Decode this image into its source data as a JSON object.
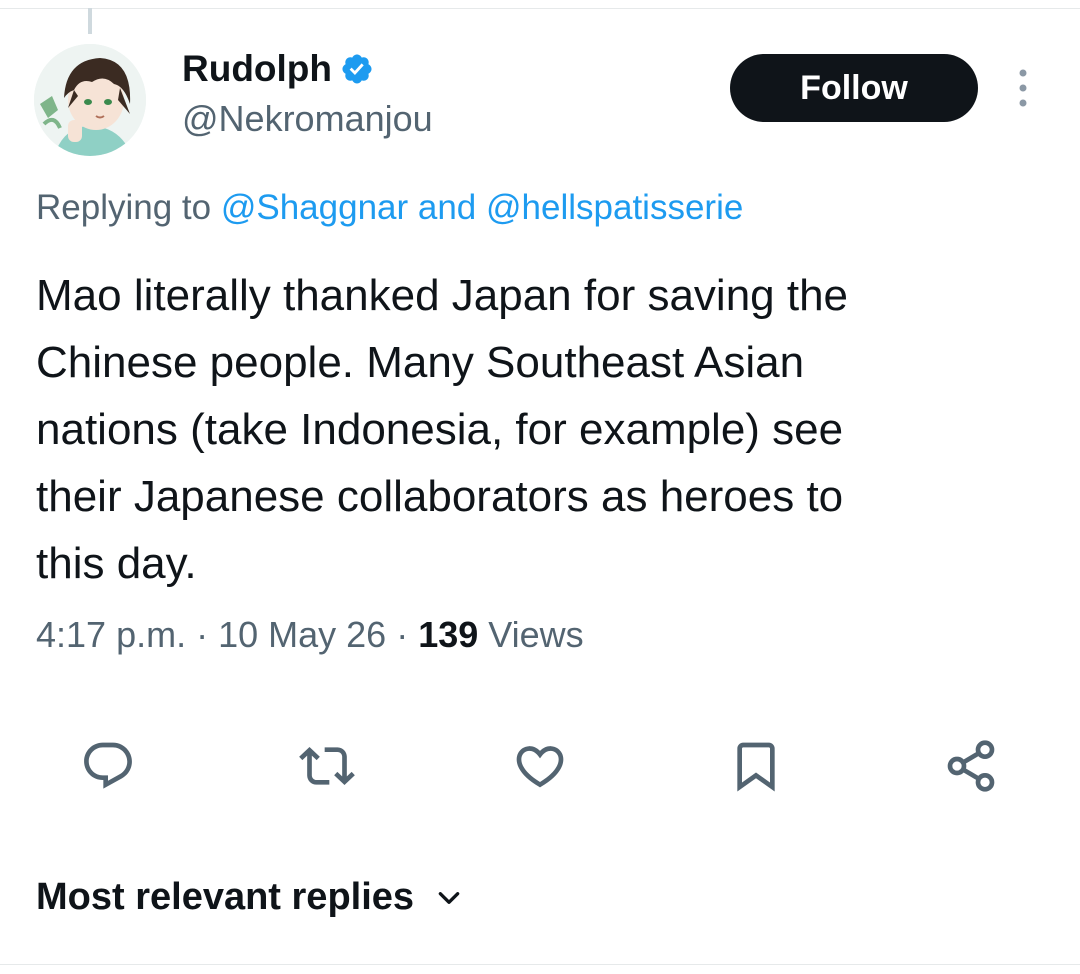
{
  "tweet": {
    "author_name": "Rudolph",
    "author_handle": "@Nekromanjou",
    "follow_label": "Follow",
    "replying_prefix": "Replying to ",
    "replying_to": [
      "@Shaggnar",
      "@hellspatisserie"
    ],
    "replying_joiner": " and ",
    "text": "Mao literally thanked Japan for saving the\nChinese people. Many Southeast Asian\nnations (take Indonesia, for example) see\ntheir Japanese collaborators as heroes to\nthis day.",
    "time": "4:17 p.m.",
    "date": "10 May 26",
    "separator": " · ",
    "views_count": "139",
    "views_label": " Views"
  },
  "actions": [
    "reply-icon",
    "retweet-icon",
    "like-icon",
    "bookmark-icon",
    "share-icon"
  ],
  "replies": {
    "sort_label": "Most relevant replies"
  },
  "colors": {
    "accent": "#1d9bf0",
    "text_primary": "#0f1419",
    "text_secondary": "#536471",
    "follow_bg": "#0f1419"
  }
}
